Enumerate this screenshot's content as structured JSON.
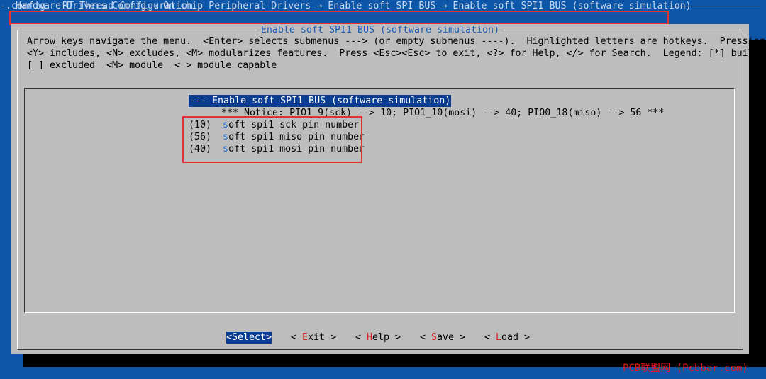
{
  "window": {
    "title": ".config - RT-Thread Configuration"
  },
  "breadcrumb": {
    "text": "Hardware Drivers Config → On-chip Peripheral Drivers → Enable soft SPI BUS → Enable soft SPI1 BUS (software simulation)",
    "dash": "-"
  },
  "dialog": {
    "title": "Enable soft SPI1 BUS (software simulation)",
    "help_text": "Arrow keys navigate the menu.  <Enter> selects submenus ---> (or empty submenus ----).  Highlighted letters are hotkeys.  Pressing\n<Y> includes, <N> excludes, <M> modularizes features.  Press <Esc><Esc> to exit, <?> for Help, </> for Search.  Legend: [*] built-in\n[ ] excluded  <M> module  < > module capable"
  },
  "menu": {
    "items": [
      {
        "prefix": "-",
        "hotkey": "-",
        "rest": "- Enable soft SPI1 BUS (software simulation)",
        "selected": true
      },
      {
        "text": "*** Notice: PIO1_9(sck) --> 10; PIO1_10(mosi) --> 40; PIO0_18(miso) --> 56 ***"
      },
      {
        "value": "(10)",
        "hotkey": "s",
        "label": "oft spi1 sck pin number"
      },
      {
        "value": "(56)",
        "hotkey": "s",
        "label": "oft spi1 miso pin number"
      },
      {
        "value": "(40)",
        "hotkey": "s",
        "label": "oft spi1 mosi pin number"
      }
    ]
  },
  "buttons": {
    "select": "<Select>",
    "exit": {
      "open": "< ",
      "hotkey": "E",
      "rest": "xit >"
    },
    "help": {
      "open": "< ",
      "hotkey": "H",
      "rest": "elp >"
    },
    "save": {
      "open": "< ",
      "hotkey": "S",
      "rest": "ave >"
    },
    "load": {
      "open": "< ",
      "hotkey": "L",
      "rest": "oad >"
    }
  },
  "watermark": "PCB联盟网 (Pcbbar.com)",
  "colors": {
    "background": "#0e56a8",
    "dialog": "#bdbdbd",
    "selection": "#0a3d8f",
    "hotkey": "#1c6fd6",
    "annotation": "#e03333"
  }
}
